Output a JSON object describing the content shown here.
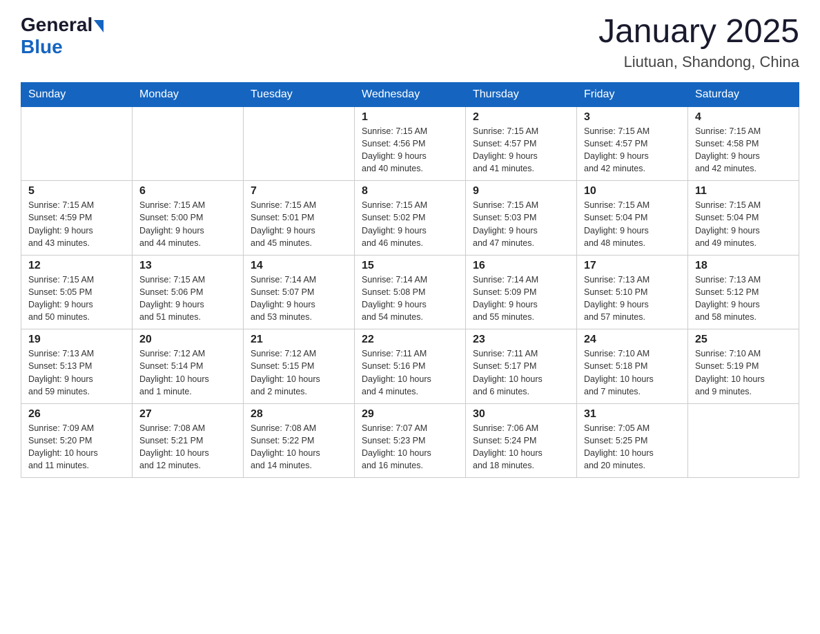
{
  "header": {
    "logo_general": "General",
    "logo_blue": "Blue",
    "month_title": "January 2025",
    "location": "Liutuan, Shandong, China"
  },
  "days_of_week": [
    "Sunday",
    "Monday",
    "Tuesday",
    "Wednesday",
    "Thursday",
    "Friday",
    "Saturday"
  ],
  "weeks": [
    [
      {
        "day": "",
        "info": ""
      },
      {
        "day": "",
        "info": ""
      },
      {
        "day": "",
        "info": ""
      },
      {
        "day": "1",
        "info": "Sunrise: 7:15 AM\nSunset: 4:56 PM\nDaylight: 9 hours\nand 40 minutes."
      },
      {
        "day": "2",
        "info": "Sunrise: 7:15 AM\nSunset: 4:57 PM\nDaylight: 9 hours\nand 41 minutes."
      },
      {
        "day": "3",
        "info": "Sunrise: 7:15 AM\nSunset: 4:57 PM\nDaylight: 9 hours\nand 42 minutes."
      },
      {
        "day": "4",
        "info": "Sunrise: 7:15 AM\nSunset: 4:58 PM\nDaylight: 9 hours\nand 42 minutes."
      }
    ],
    [
      {
        "day": "5",
        "info": "Sunrise: 7:15 AM\nSunset: 4:59 PM\nDaylight: 9 hours\nand 43 minutes."
      },
      {
        "day": "6",
        "info": "Sunrise: 7:15 AM\nSunset: 5:00 PM\nDaylight: 9 hours\nand 44 minutes."
      },
      {
        "day": "7",
        "info": "Sunrise: 7:15 AM\nSunset: 5:01 PM\nDaylight: 9 hours\nand 45 minutes."
      },
      {
        "day": "8",
        "info": "Sunrise: 7:15 AM\nSunset: 5:02 PM\nDaylight: 9 hours\nand 46 minutes."
      },
      {
        "day": "9",
        "info": "Sunrise: 7:15 AM\nSunset: 5:03 PM\nDaylight: 9 hours\nand 47 minutes."
      },
      {
        "day": "10",
        "info": "Sunrise: 7:15 AM\nSunset: 5:04 PM\nDaylight: 9 hours\nand 48 minutes."
      },
      {
        "day": "11",
        "info": "Sunrise: 7:15 AM\nSunset: 5:04 PM\nDaylight: 9 hours\nand 49 minutes."
      }
    ],
    [
      {
        "day": "12",
        "info": "Sunrise: 7:15 AM\nSunset: 5:05 PM\nDaylight: 9 hours\nand 50 minutes."
      },
      {
        "day": "13",
        "info": "Sunrise: 7:15 AM\nSunset: 5:06 PM\nDaylight: 9 hours\nand 51 minutes."
      },
      {
        "day": "14",
        "info": "Sunrise: 7:14 AM\nSunset: 5:07 PM\nDaylight: 9 hours\nand 53 minutes."
      },
      {
        "day": "15",
        "info": "Sunrise: 7:14 AM\nSunset: 5:08 PM\nDaylight: 9 hours\nand 54 minutes."
      },
      {
        "day": "16",
        "info": "Sunrise: 7:14 AM\nSunset: 5:09 PM\nDaylight: 9 hours\nand 55 minutes."
      },
      {
        "day": "17",
        "info": "Sunrise: 7:13 AM\nSunset: 5:10 PM\nDaylight: 9 hours\nand 57 minutes."
      },
      {
        "day": "18",
        "info": "Sunrise: 7:13 AM\nSunset: 5:12 PM\nDaylight: 9 hours\nand 58 minutes."
      }
    ],
    [
      {
        "day": "19",
        "info": "Sunrise: 7:13 AM\nSunset: 5:13 PM\nDaylight: 9 hours\nand 59 minutes."
      },
      {
        "day": "20",
        "info": "Sunrise: 7:12 AM\nSunset: 5:14 PM\nDaylight: 10 hours\nand 1 minute."
      },
      {
        "day": "21",
        "info": "Sunrise: 7:12 AM\nSunset: 5:15 PM\nDaylight: 10 hours\nand 2 minutes."
      },
      {
        "day": "22",
        "info": "Sunrise: 7:11 AM\nSunset: 5:16 PM\nDaylight: 10 hours\nand 4 minutes."
      },
      {
        "day": "23",
        "info": "Sunrise: 7:11 AM\nSunset: 5:17 PM\nDaylight: 10 hours\nand 6 minutes."
      },
      {
        "day": "24",
        "info": "Sunrise: 7:10 AM\nSunset: 5:18 PM\nDaylight: 10 hours\nand 7 minutes."
      },
      {
        "day": "25",
        "info": "Sunrise: 7:10 AM\nSunset: 5:19 PM\nDaylight: 10 hours\nand 9 minutes."
      }
    ],
    [
      {
        "day": "26",
        "info": "Sunrise: 7:09 AM\nSunset: 5:20 PM\nDaylight: 10 hours\nand 11 minutes."
      },
      {
        "day": "27",
        "info": "Sunrise: 7:08 AM\nSunset: 5:21 PM\nDaylight: 10 hours\nand 12 minutes."
      },
      {
        "day": "28",
        "info": "Sunrise: 7:08 AM\nSunset: 5:22 PM\nDaylight: 10 hours\nand 14 minutes."
      },
      {
        "day": "29",
        "info": "Sunrise: 7:07 AM\nSunset: 5:23 PM\nDaylight: 10 hours\nand 16 minutes."
      },
      {
        "day": "30",
        "info": "Sunrise: 7:06 AM\nSunset: 5:24 PM\nDaylight: 10 hours\nand 18 minutes."
      },
      {
        "day": "31",
        "info": "Sunrise: 7:05 AM\nSunset: 5:25 PM\nDaylight: 10 hours\nand 20 minutes."
      },
      {
        "day": "",
        "info": ""
      }
    ]
  ]
}
